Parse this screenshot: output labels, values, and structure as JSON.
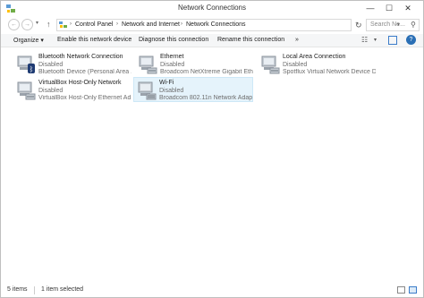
{
  "window": {
    "title": "Network Connections",
    "controls": {
      "minimize": "—",
      "maximize": "☐",
      "close": "✕"
    }
  },
  "address_bar": {
    "breadcrumbs": [
      "Control Panel",
      "Network and Internet",
      "Network Connections"
    ],
    "search_placeholder": "Search Ne..."
  },
  "command_bar": {
    "organize": "Organize ▾",
    "enable": "Enable this network device",
    "diagnose": "Diagnose this connection",
    "rename": "Rename this connection",
    "more": "»"
  },
  "items": [
    {
      "name": "Bluetooth Network Connection",
      "status": "Disabled",
      "device": "Bluetooth Device (Personal Area ..."
    },
    {
      "name": "Ethernet",
      "status": "Disabled",
      "device": "Broadcom NetXtreme Gigabit Eth..."
    },
    {
      "name": "Local Area Connection",
      "status": "Disabled",
      "device": "Spotflux Virtual Network Device D..."
    },
    {
      "name": "VirtualBox Host-Only Network",
      "status": "Disabled",
      "device": "VirtualBox Host-Only Ethernet Ad..."
    },
    {
      "name": "Wi-Fi",
      "status": "Disabled",
      "device": "Broadcom 802.11n Network Adap...",
      "selected": true
    }
  ],
  "status_bar": {
    "count": "5 items",
    "selection": "1 item selected"
  },
  "colors": {
    "selection_bg": "#e5f3fb",
    "accent": "#2a6fb5",
    "status_text": "#6d6d6d"
  }
}
